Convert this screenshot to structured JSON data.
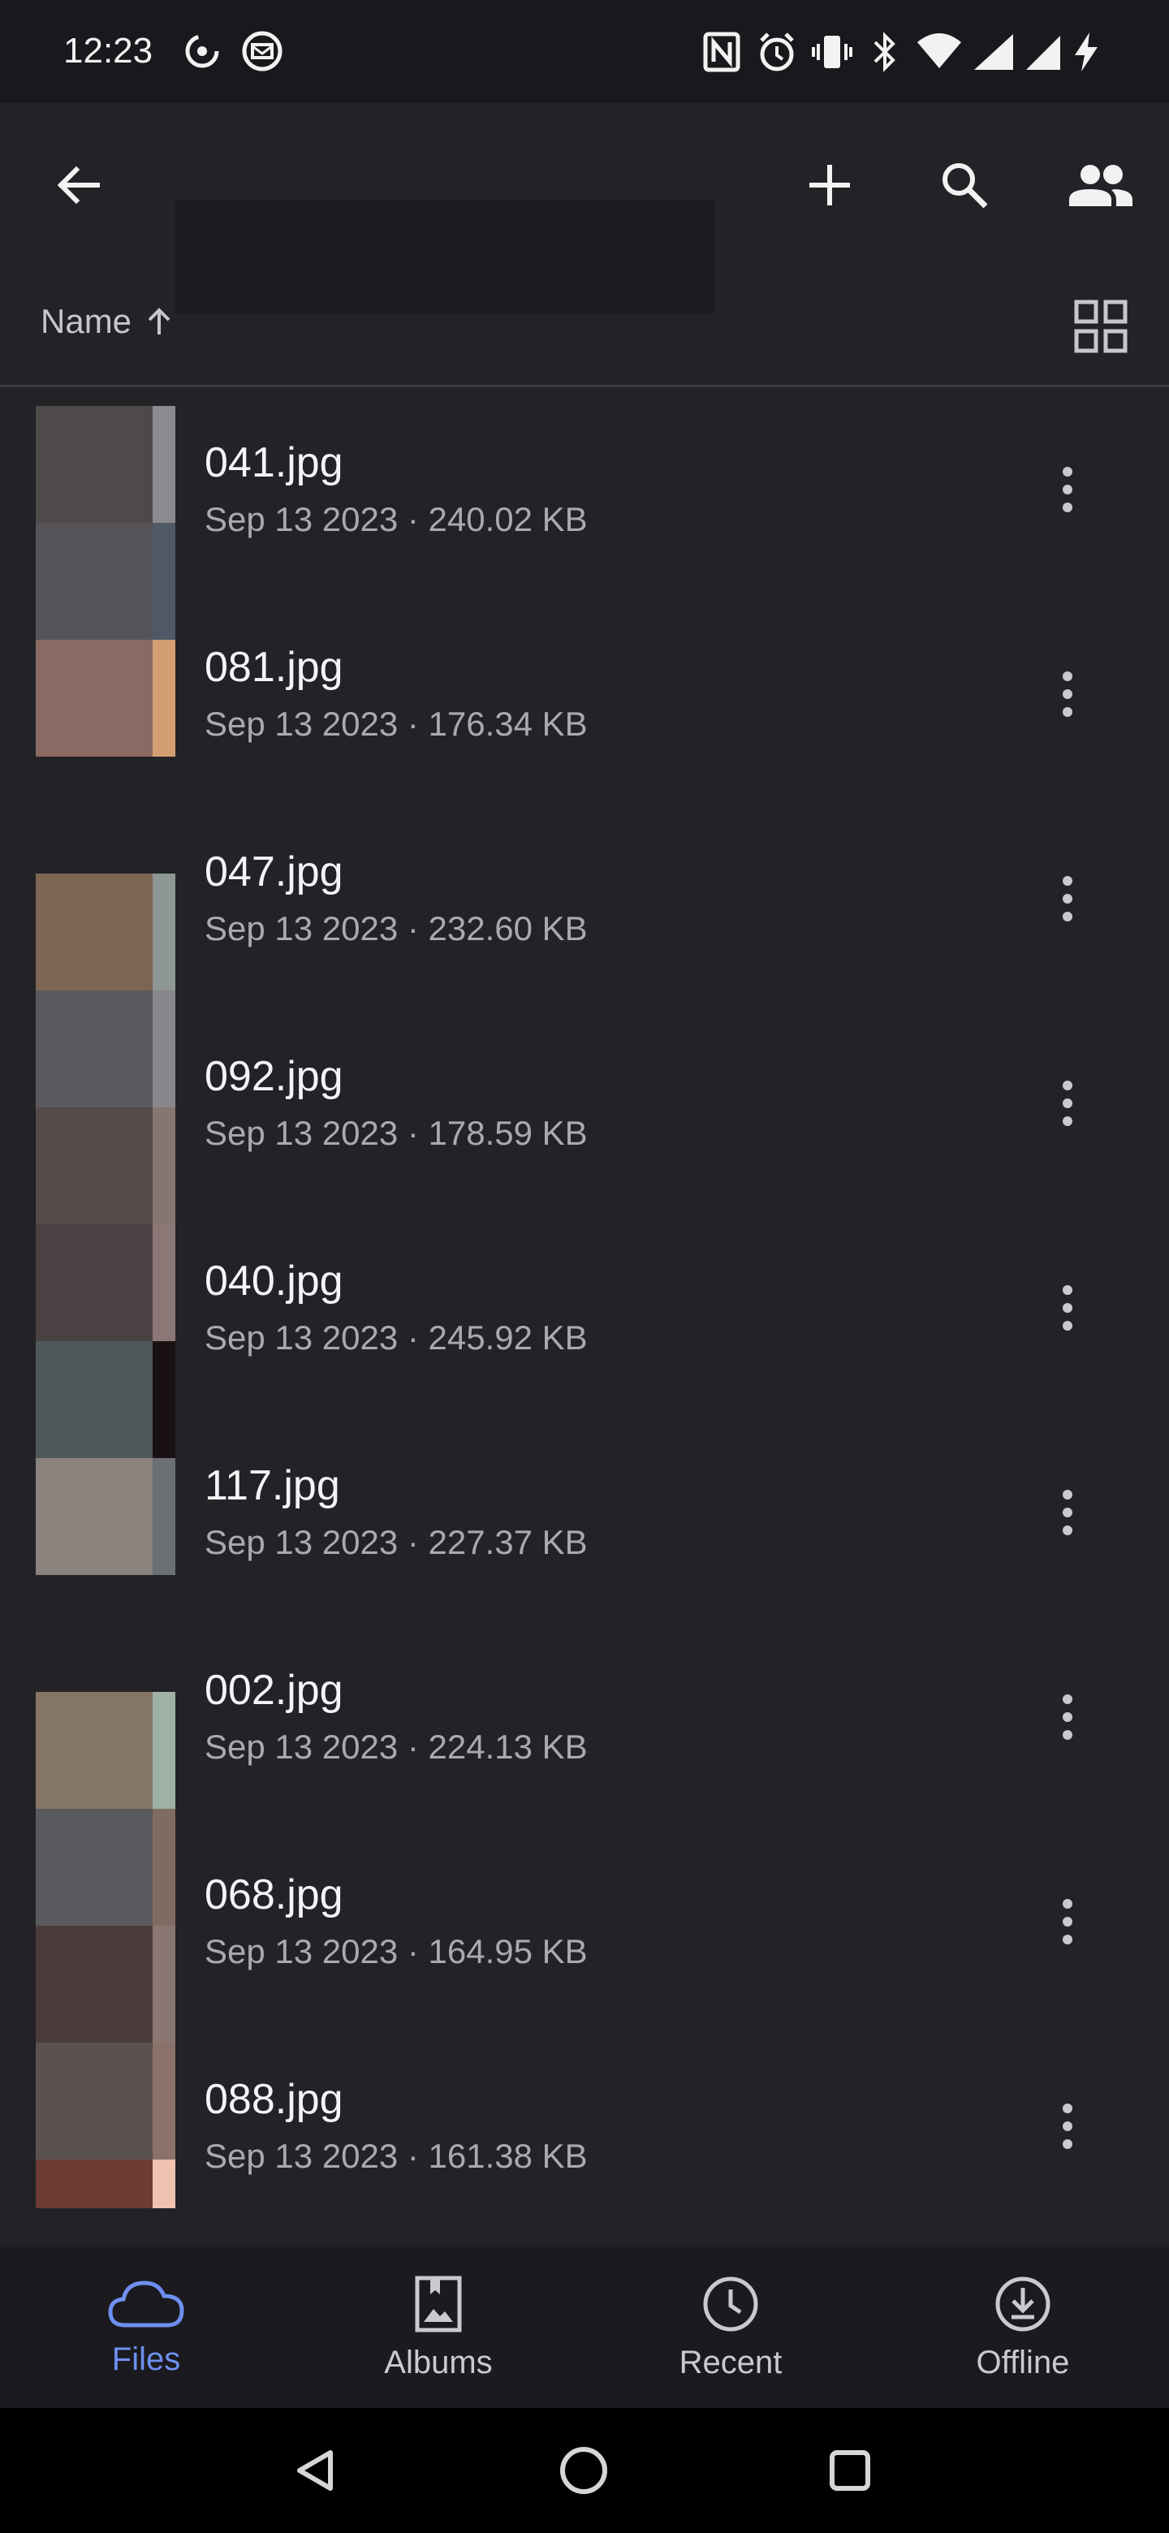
{
  "status_bar": {
    "time": "12:23",
    "left_icons": [
      "sync-icon",
      "mail-icon"
    ],
    "right_icons": [
      "nfc-icon",
      "alarm-icon",
      "vibrate-icon",
      "bluetooth-icon",
      "wifi-icon",
      "signal-icon",
      "signal-icon",
      "battery-charging-icon"
    ]
  },
  "app_bar": {
    "back_icon": "arrow-left-icon",
    "actions": [
      "plus-icon",
      "search-icon",
      "people-icon"
    ]
  },
  "sort": {
    "label": "Name",
    "direction_icon": "arrow-up-icon",
    "view_toggle_icon": "grid-icon"
  },
  "files": [
    {
      "name": "041.jpg",
      "meta": "Sep 13 2023 · 240.02 KB"
    },
    {
      "name": "081.jpg",
      "meta": "Sep 13 2023 · 176.34 KB"
    },
    {
      "name": "047.jpg",
      "meta": "Sep 13 2023 · 232.60 KB"
    },
    {
      "name": "092.jpg",
      "meta": "Sep 13 2023 · 178.59 KB"
    },
    {
      "name": "040.jpg",
      "meta": "Sep 13 2023 · 245.92 KB"
    },
    {
      "name": "117.jpg",
      "meta": "Sep 13 2023 · 227.37 KB"
    },
    {
      "name": "002.jpg",
      "meta": "Sep 13 2023 · 224.13 KB"
    },
    {
      "name": "068.jpg",
      "meta": "Sep 13 2023 · 164.95 KB"
    },
    {
      "name": "088.jpg",
      "meta": "Sep 13 2023 · 161.38 KB"
    }
  ],
  "thumb_colors": [
    [
      "#4f4a4a",
      "#8a8a90"
    ],
    [
      "#565458",
      "#4e5965"
    ],
    [
      "#8a6a62",
      "#d29e72"
    ],
    [
      "#7e6452",
      "#8d9794"
    ],
    [
      "#5b5a5f",
      "#88878b"
    ],
    [
      "#554b49",
      "#86766f"
    ],
    [
      "#4a4242",
      "#8b7876"
    ],
    [
      "#50575b",
      "#1a1112"
    ],
    [
      "#8a827d",
      "#6c7074"
    ],
    [
      "#857565",
      "#9fb0a6"
    ],
    [
      "#5a595d",
      "#7e6b62"
    ],
    [
      "#4b3c3b",
      "#8a7774"
    ],
    [
      "#5b524f",
      "#8a716a"
    ],
    [
      "#6d3c32",
      "#f0c2b1"
    ]
  ],
  "bottom_nav": [
    {
      "label": "Files",
      "icon": "cloud-icon",
      "active": true
    },
    {
      "label": "Albums",
      "icon": "album-icon",
      "active": false
    },
    {
      "label": "Recent",
      "icon": "clock-icon",
      "active": false
    },
    {
      "label": "Offline",
      "icon": "download-icon",
      "active": false
    }
  ],
  "accent_color": "#6f8ff0"
}
